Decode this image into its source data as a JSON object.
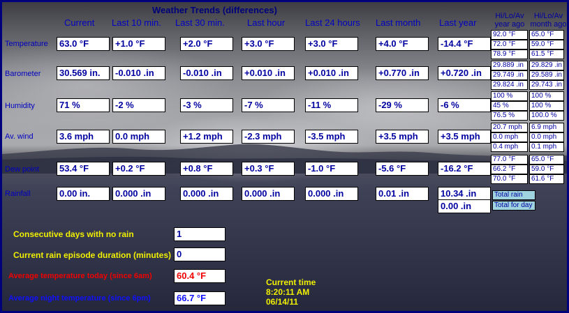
{
  "title": "Weather Trends (differences)",
  "columns": [
    "Current",
    "Last 10 min.",
    "Last 30 min.",
    "Last hour",
    "Last 24 hours",
    "Last month",
    "Last year"
  ],
  "hilo_headers": {
    "year_ago": [
      "Hi/Lo/Av",
      "year ago"
    ],
    "month_ago": [
      "Hi/Lo/Av",
      "month ago"
    ]
  },
  "rows": [
    {
      "label": "Temperature",
      "values": [
        "63.0 °F",
        "+1.0 °F",
        "+2.0 °F",
        "+3.0 °F",
        "+3.0 °F",
        "+4.0 °F",
        "-14.4 °F"
      ],
      "year_ago": [
        "92.0 °F",
        "72.0 °F",
        "78.9 °F"
      ],
      "month_ago": [
        "65.0 °F",
        "59.0 °F",
        "61.5 °F"
      ]
    },
    {
      "label": "Barometer",
      "values": [
        "30.569 in.",
        "-0.010 .in",
        "-0.010 .in",
        "+0.010 .in",
        "+0.010 .in",
        "+0.770 .in",
        "+0.720 .in"
      ],
      "year_ago": [
        "29.889 .in",
        "29.749 .in",
        "29.824 .in"
      ],
      "month_ago": [
        "29.829 .in",
        "29.589 .in",
        "29.743 .in"
      ]
    },
    {
      "label": "Humidity",
      "values": [
        "71 %",
        "-2 %",
        "-3 %",
        "-7 %",
        "-11 %",
        "-29 %",
        "-6 %"
      ],
      "year_ago": [
        "100 %",
        "45 %",
        "76.5 %"
      ],
      "month_ago": [
        "100 %",
        "100 %",
        "100.0 %"
      ]
    },
    {
      "label": "Av. wind",
      "values": [
        "3.6 mph",
        "0.0 mph",
        "+1.2 mph",
        "-2.3 mph",
        "-3.5 mph",
        "+3.5 mph",
        "+3.5 mph"
      ],
      "year_ago": [
        "20.7 mph",
        "0.0 mph",
        "0.4 mph"
      ],
      "month_ago": [
        "6.9 mph",
        "0.0 mph",
        "0.1 mph"
      ]
    },
    {
      "label": "Dew point",
      "values": [
        "53.4 °F",
        "+0.2 °F",
        "+0.8 °F",
        "+0.3 °F",
        "-1.0 °F",
        "-5.6 °F",
        "-16.2 °F"
      ],
      "year_ago": [
        "77.0 °F",
        "66.2 °F",
        "70.0 °F"
      ],
      "month_ago": [
        "65.0 °F",
        "59.0 °F",
        "61.6 °F"
      ]
    },
    {
      "label": "Rainfall",
      "values": [
        "0.00 in.",
        "0.000 .in",
        "0.000 .in",
        "0.000 .in",
        "0.000 .in",
        "0.01 .in",
        "10.34 .in"
      ]
    }
  ],
  "rain_year_today": "0.00 .in",
  "rain_tags": [
    "Total rain",
    "Total for day"
  ],
  "bottom": {
    "consecutive_days_label": "Consecutive days with no rain",
    "consecutive_days_value": "1",
    "rain_duration_label": "Current rain episode duration (minutes)",
    "rain_duration_value": "0",
    "avg_temp_label": "Average temperature today (since 6am)",
    "avg_temp_value": "60.4 °F",
    "avg_night_label": "Average night temperature (since 6pm)",
    "avg_night_value": "66.7 °F"
  },
  "time": {
    "label": "Current time",
    "time": "8:20:11 AM",
    "date": "06/14/11"
  },
  "colors": {
    "frame": "#00007a",
    "value_text": "#0000a0",
    "label_yellow": "#f0f000",
    "label_red": "#f00000",
    "label_blue": "#1010ff",
    "tag_bg": "#9fd3df"
  }
}
